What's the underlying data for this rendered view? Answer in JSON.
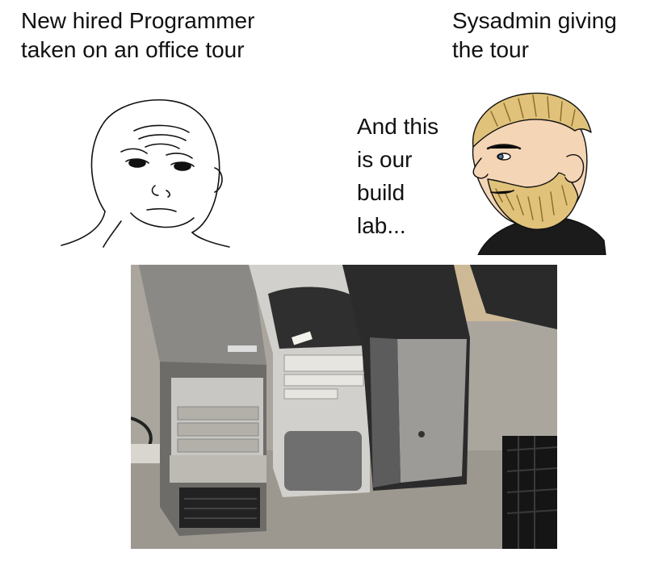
{
  "captions": {
    "left": "New hired Programmer taken on an office tour",
    "right": "Sysadmin giving the tour"
  },
  "speech": {
    "lines": [
      "And this",
      "is our",
      "build",
      "lab..."
    ]
  },
  "illustrations": {
    "left_face": "wojak-face",
    "right_face": "chad-sysadmin-face",
    "photo": "old-desktop-towers-photo"
  }
}
